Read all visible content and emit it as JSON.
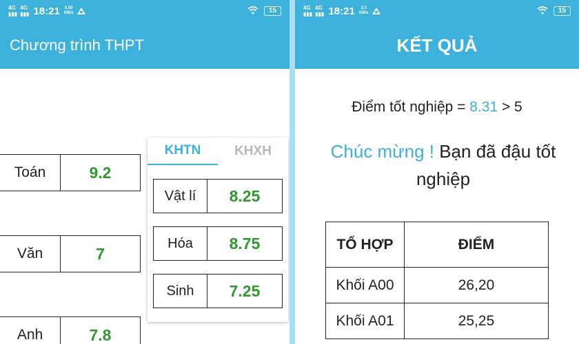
{
  "status_left": {
    "sig1": "4G",
    "sig2": "4G",
    "time": "18:21",
    "speed_value": "0.00",
    "speed_unit": "KB/s",
    "battery": "15"
  },
  "status_right": {
    "sig1": "4G",
    "sig2": "4G",
    "time": "18:21",
    "speed_value": "3.5",
    "speed_unit": "KB/s",
    "battery": "15"
  },
  "left": {
    "appbar_title": "Chương trình THPT",
    "subjects": [
      {
        "name": "Toán",
        "score": "9.2"
      },
      {
        "name": "Văn",
        "score": "7"
      },
      {
        "name": "Anh",
        "score": "7.8"
      }
    ],
    "tabs": [
      {
        "label": "KHTN",
        "active": true
      },
      {
        "label": "KHXH",
        "active": false
      }
    ],
    "card_subjects": [
      {
        "name": "Vật lí",
        "score": "8.25"
      },
      {
        "name": "Hóa",
        "score": "8.75"
      },
      {
        "name": "Sinh",
        "score": "7.25"
      }
    ]
  },
  "right": {
    "title": "KẾT QUẢ",
    "grad_prefix": "Điểm tốt nghiệp = ",
    "grad_score": "8.31",
    "grad_suffix": " > 5",
    "congrats": "Chúc mừng !",
    "message": " Bạn đã đậu tốt nghiệp",
    "table": {
      "headers": [
        "TỔ HỢP",
        "ĐIỂM"
      ],
      "rows": [
        [
          "Khối A00",
          "26,20"
        ],
        [
          "Khối A01",
          "25,25"
        ]
      ]
    }
  },
  "colors": {
    "primary": "#3bb1dc",
    "score_green": "#2f9a2f",
    "divider": "#a8e0ef"
  },
  "icons": {
    "status": [
      "signal-icon",
      "notification-icon",
      "wifi-icon",
      "battery-icon"
    ]
  }
}
